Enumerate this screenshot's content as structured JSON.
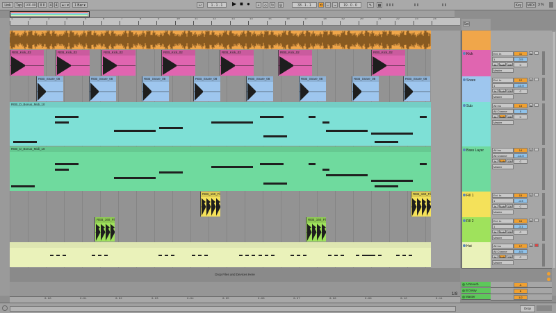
{
  "topbar": {
    "link": "Link",
    "tap": "Tap",
    "tempo": "100.00",
    "tempo_mult": "II II",
    "meter_num": "4",
    "meter_den": "4",
    "metro": "●○ ▾",
    "quant": "1 Bar ▾",
    "position": "1 . 1 . 1",
    "loop_start": "33 . 1 . 1",
    "loop_len": "19 . 0 . 0",
    "key": "Key",
    "midi": "MIDI",
    "cpu": "3 %"
  },
  "ruler_labels": [
    "1",
    "2",
    "3",
    "4",
    "5",
    "6",
    "7",
    "8",
    "9",
    "10",
    "11",
    "12",
    "13",
    "14",
    "15",
    "16",
    "17",
    "18",
    "19",
    "20",
    "21",
    "22",
    "23",
    "24"
  ],
  "tracks": [
    {
      "name": "",
      "color": "#f0a64a",
      "type": "audio-full",
      "height": 28,
      "num": "",
      "vol": "",
      "pan": "",
      "inp": "",
      "inch": ""
    },
    {
      "name": "Kick",
      "color": "#e065b0",
      "type": "audio",
      "height": 38,
      "num": "11",
      "vol": "-3.5",
      "pan": "C",
      "inp": "Ext. In",
      "inch": "1",
      "clip": "REB_Kick_02",
      "clipStarts": [
        0,
        66,
        132,
        218,
        302,
        386,
        520
      ]
    },
    {
      "name": "Snare",
      "color": "#9ec6ee",
      "type": "audio",
      "height": 37,
      "num": "12",
      "vol": "-13.0",
      "pan": "C",
      "inp": "Ext. In",
      "inch": "1",
      "clip": "REB_Snare_08",
      "clipStarts": [
        38,
        114,
        190,
        264,
        340,
        416,
        492,
        566
      ]
    },
    {
      "name": "Sub",
      "color": "#7ee0d6",
      "type": "midi",
      "height": 64,
      "num": "13",
      "vol": "0",
      "pan": "C",
      "inp": "All Ins",
      "inch": "All Channe",
      "clip": "REB_D_Bonus_Midi_10"
    },
    {
      "name": "Bass Layer",
      "color": "#6fda9e",
      "type": "midi",
      "height": 65,
      "num": "14",
      "vol": "-14.0",
      "pan": "C",
      "inp": "All Ins",
      "inch": "All Channe",
      "clip": "REB_D_Bonus_Midi_10"
    },
    {
      "name": "Fill 1",
      "color": "#f4e15a",
      "type": "fill",
      "height": 37,
      "num": "15",
      "vol": "-4.3",
      "pan": "C",
      "inp": "Ext. In",
      "inch": "1",
      "clip": "REB_160_Fill",
      "clipStarts": [
        274,
        577
      ]
    },
    {
      "name": "Fill 2",
      "color": "#9fe25c",
      "type": "fill",
      "height": 36,
      "num": "16",
      "vol": "-3.1",
      "pan": "C",
      "inp": "Ext. In",
      "inch": "1",
      "clip": "REB_160_Fill",
      "clipStarts": [
        122,
        426
      ]
    },
    {
      "name": "Hat",
      "color": "#eaf2ba",
      "type": "hat",
      "height": 37,
      "num": "17",
      "vol": "-5.5",
      "pan": "C",
      "inp": "All Ins",
      "inch": "All Channe",
      "clip": ""
    }
  ],
  "dropzone": "Drop Files and Devices Here",
  "returns": [
    {
      "name": "A Reverb",
      "letter": "A",
      "color": "#5dc85a"
    },
    {
      "name": "B Delay",
      "letter": "B",
      "color": "#5dc85a"
    },
    {
      "name": "Master",
      "letter": "1/2",
      "color": "#5dc85a"
    }
  ],
  "mixer": {
    "auto": "Auto",
    "in": "In",
    "off": "Off",
    "master": "Master",
    "s": "S",
    "m": "M"
  },
  "bottom_time": [
    "0:00",
    "0:01",
    "0:02",
    "0:03",
    "0:04",
    "0:05",
    "0:06",
    "0:07",
    "0:08",
    "0:09",
    "0:10",
    "0:11",
    "0:12"
  ],
  "status": {
    "page": "1/8",
    "right": "Drop"
  },
  "set_label": "Set"
}
